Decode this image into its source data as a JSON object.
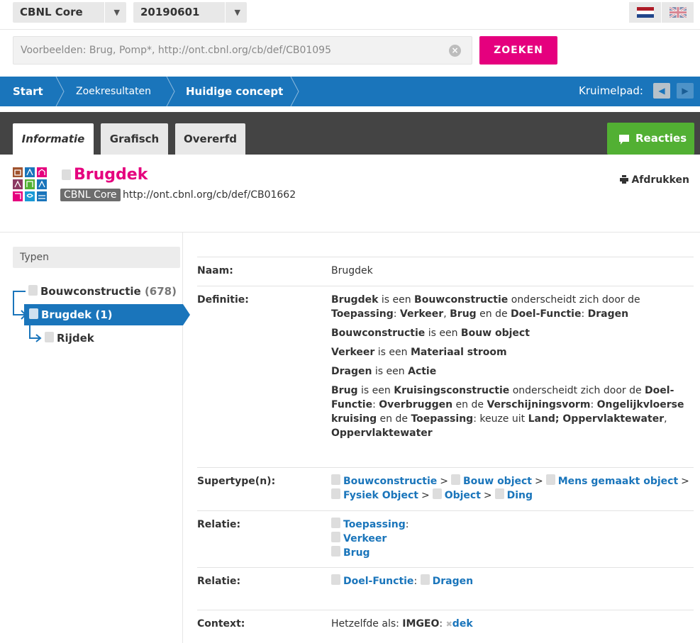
{
  "topbar": {
    "dataset_select": "CBNL Core",
    "version_select": "20190601",
    "flags": [
      "dutch-flag-icon",
      "uk-flag-icon"
    ]
  },
  "search": {
    "placeholder": "Voorbeelden: Brug, Pomp*, http://ont.cbnl.org/cb/def/CB01095",
    "button_label": "ZOEKEN"
  },
  "breadcrumb": {
    "items": [
      "Start",
      "Zoekresultaten",
      "Huidige concept"
    ],
    "kruimelpad_label": "Kruimelpad:"
  },
  "tabs": {
    "items": [
      "Informatie",
      "Grafisch",
      "Overerfd"
    ],
    "active": "Informatie",
    "reacties_label": "Reacties"
  },
  "concept": {
    "title": "Brugdek",
    "source_badge": "CBNL Core",
    "uri": "http://ont.cbnl.org/cb/def/CB01662",
    "print_label": "Afdrukken"
  },
  "colors": {
    "brand_blue": "#1a75bb",
    "brand_pink": "#e5007e",
    "reacties_green": "#52b033"
  },
  "sidebar": {
    "filter_label": "Typen",
    "tree": [
      {
        "label": "Bouwconstructie",
        "count": "(678)"
      },
      {
        "label": "Brugdek",
        "count": "(1)"
      },
      {
        "label": "Rijdek"
      }
    ]
  },
  "details": {
    "naam": {
      "label": "Naam:",
      "value": "Brugdek"
    },
    "definitie": {
      "label": "Definitie:",
      "lines": [
        [
          "Brugdek",
          " is een ",
          "Bouwconstructie",
          " onderscheidt zich door de ",
          "Toepassing",
          ": ",
          "Verkeer",
          ", ",
          "Brug",
          " en de ",
          "Doel-Functie",
          ": ",
          "Dragen"
        ],
        [
          "Bouwconstructie",
          " is een ",
          "Bouw object"
        ],
        [
          "Verkeer",
          " is een ",
          "Materiaal stroom"
        ],
        [
          "Dragen",
          " is een ",
          "Actie"
        ],
        [
          "Brug",
          " is een ",
          "Kruisingsconstructie",
          " onderscheidt zich door de ",
          "Doel-Functie",
          ": ",
          "Overbruggen",
          " en de ",
          "Verschijningsvorm",
          ": ",
          "Ongelijkvloerse kruising",
          " en de ",
          "Toepassing",
          ": keuze uit ",
          "Land; Oppervlaktewater",
          ", ",
          "Oppervlaktewater"
        ]
      ]
    },
    "supertypen": {
      "label": "Supertype(n):",
      "items": [
        "Bouwconstructie",
        "Bouw object",
        "Mens gemaakt object",
        "Fysiek Object",
        "Object",
        "Ding"
      ]
    },
    "relatie1": {
      "label": "Relatie:",
      "head": "Toepassing",
      "items": [
        "Verkeer",
        "Brug"
      ]
    },
    "relatie2": {
      "label": "Relatie:",
      "items": [
        "Doel-Functie",
        "Dragen"
      ]
    },
    "context": {
      "label": "Context:",
      "prefix": "Hetzelfde als:",
      "source": "IMGEO",
      "link": "dek"
    }
  }
}
